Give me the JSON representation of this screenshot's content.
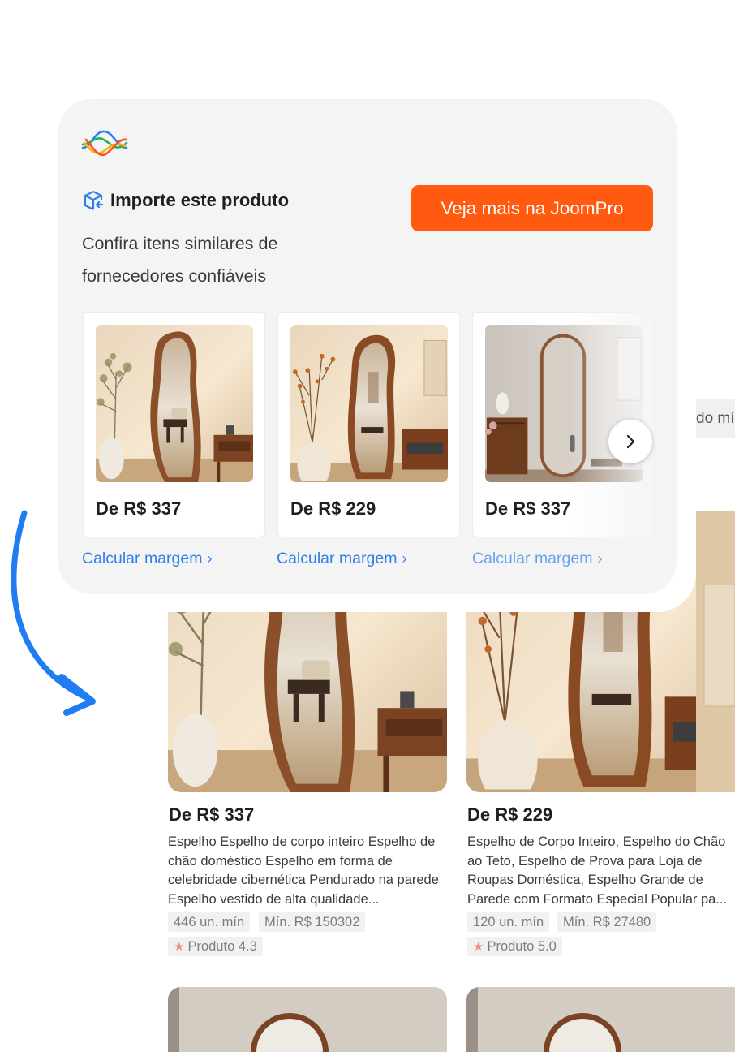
{
  "panel": {
    "import_title": "Importe este produto",
    "subtitle": "Confira itens similares de fornecedores confiáveis",
    "cta_label": "Veja mais na JoomPro",
    "brand_colors": {
      "cta": "#ff5a10",
      "link": "#2f80ed"
    },
    "cards": [
      {
        "price": "De R$ 337",
        "link": "Calcular margem"
      },
      {
        "price": "De R$ 229",
        "link": "Calcular margem"
      },
      {
        "price": "De R$ 337",
        "link": "Calcular margem"
      }
    ],
    "next_icon": "chevron-right-icon"
  },
  "peek": {
    "text": "do mí"
  },
  "listing": [
    {
      "price": "De R$ 337",
      "description": "Espelho Espelho de corpo inteiro Espelho de chão doméstico Espelho em forma de celebridade cibernética Pendurado na parede Espelho vestido de alta qualidade...",
      "min_units": "446 un. mín",
      "min_value": "Mín. R$ 150302",
      "rating": "Produto 4.3"
    },
    {
      "price": "De R$ 229",
      "description": "Espelho de Corpo Inteiro, Espelho do Chão ao Teto, Espelho de Prova para Loja de Roupas Doméstica, Espelho Grande de Parede com Formato Especial Popular pa...",
      "min_units": "120 un. mín",
      "min_value": "Mín. R$ 27480",
      "rating": "Produto 5.0"
    }
  ]
}
